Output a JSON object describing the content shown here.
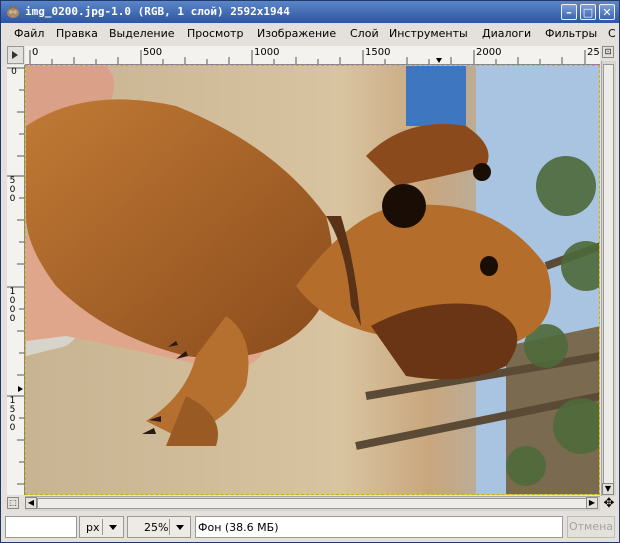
{
  "window": {
    "title": "img_0200.jpg-1.0 (RGB, 1 слой) 2592x1944",
    "app_icon": "gimp-wilber-icon",
    "buttons": [
      "minimize-icon",
      "maximize-icon",
      "close-icon"
    ],
    "title_color": "#2c55a3"
  },
  "menu": {
    "items": [
      "Файл",
      "Правка",
      "Выделение",
      "Просмотр",
      "Изображение",
      "Слой",
      "Инструменты",
      "Диалоги",
      "Фильтры",
      "С"
    ]
  },
  "ruler_h": {
    "labels": [
      "0",
      "500",
      "1000",
      "1500",
      "2000",
      "25"
    ]
  },
  "ruler_v": {
    "labels": [
      "0",
      "500",
      "1000",
      "1500"
    ]
  },
  "statusbar": {
    "pointer_coords": "",
    "unit": "px",
    "zoom": "25%",
    "info": "Фон (38.6 МБ)",
    "cancel_label": "Отмена"
  }
}
